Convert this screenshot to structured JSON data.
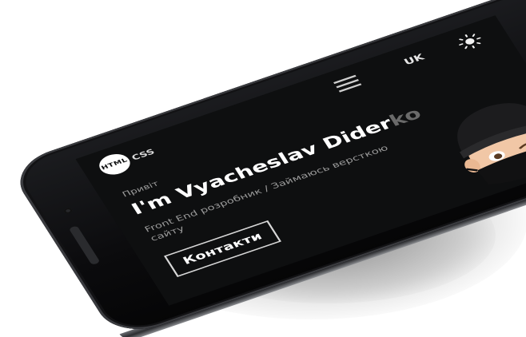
{
  "site": {
    "logo_text": "HTML",
    "logo_badge": "CSS",
    "language": "UK",
    "greeting": "Привіт",
    "title_main": "I'm Vyacheslav Dider",
    "title_faded": "ko",
    "subtitle": "Front End розробник / Займаюсь версткою сайту",
    "contact_label": "Контакти"
  },
  "icons": {
    "menu": "hamburger-menu-icon",
    "theme": "sun-icon",
    "avatar": "memoji-avatar"
  },
  "colors": {
    "screen_bg": "#0e0f10",
    "text": "#ffffff",
    "muted": "#9a9a9a"
  }
}
